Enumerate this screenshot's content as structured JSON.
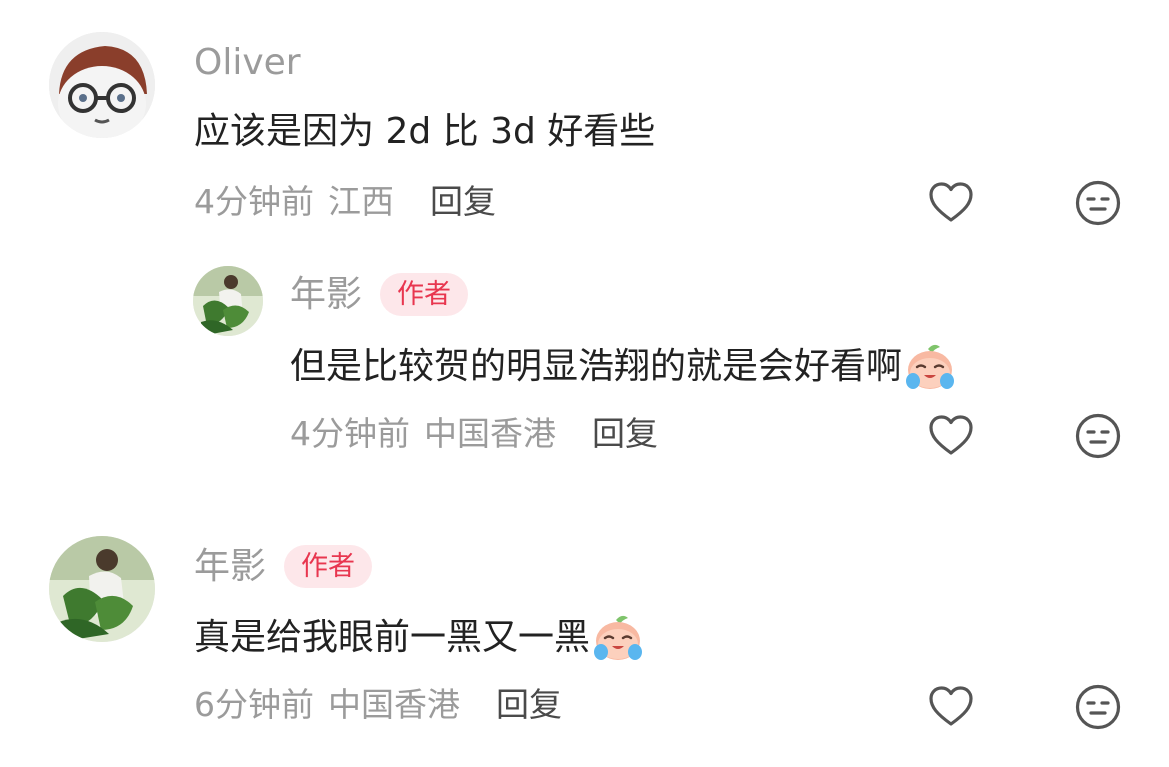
{
  "comments": [
    {
      "username": "Oliver",
      "text": "应该是因为 2d 比 3d 好看些",
      "time": "4分钟前",
      "location": "江西",
      "reply_label": "回复"
    },
    {
      "username": "年影",
      "badge": "作者",
      "text": "但是比较贺的明显浩翔的就是会好看啊",
      "time": "4分钟前",
      "location": "中国香港",
      "reply_label": "回复"
    },
    {
      "username": "年影",
      "badge": "作者",
      "text": "真是给我眼前一黑又一黑",
      "time": "6分钟前",
      "location": "中国香港",
      "reply_label": "回复"
    }
  ],
  "icons": {
    "like": "heart-icon",
    "dislike": "neutral-face-icon",
    "emoji": "crying-peach-emoji"
  },
  "colors": {
    "muted_text": "#9b9b9b",
    "badge_bg": "#fde7ea",
    "badge_text": "#e8364f",
    "icon_stroke": "#555555"
  }
}
